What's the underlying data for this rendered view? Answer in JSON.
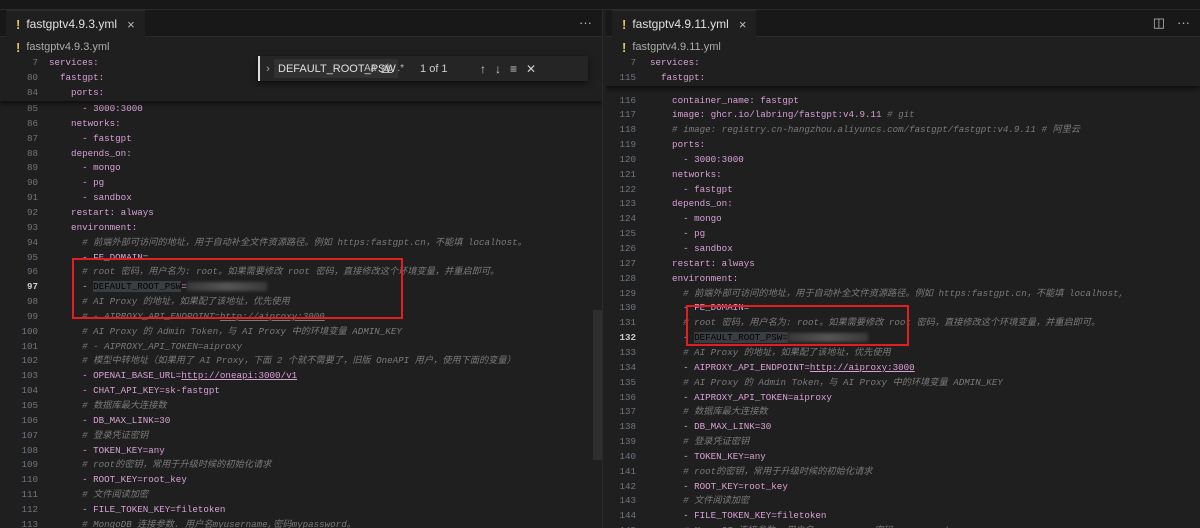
{
  "colors": {
    "background": "#1f1f1f",
    "key": "#d8a0d6",
    "comment": "#7a7a7a",
    "highlight_box": "#e02020"
  },
  "find_widget": {
    "query": "DEFAULT_ROOT_PSW",
    "match_case": "Aa",
    "whole_word": "ab",
    "regex": ".*",
    "count": "1 of 1",
    "icons": [
      "arrow-up-icon",
      "arrow-down-icon",
      "find-in-selection-icon",
      "close-icon"
    ]
  },
  "left": {
    "tab": "fastgptv4.9.3.yml",
    "breadcrumb": "fastgptv4.9.3.yml",
    "current_line": "97",
    "sticky": [
      {
        "num": "7",
        "segs": [
          [
            "services:",
            "key"
          ]
        ]
      },
      {
        "num": "80",
        "segs": [
          [
            "  fastgpt:",
            "key"
          ]
        ]
      },
      {
        "num": "84",
        "segs": [
          [
            "    ports:",
            "key"
          ]
        ]
      }
    ],
    "lines": [
      {
        "num": "85",
        "segs": [
          [
            "      - 3000:3000",
            "item"
          ]
        ]
      },
      {
        "num": "86",
        "segs": [
          [
            "    networks:",
            "key"
          ]
        ]
      },
      {
        "num": "87",
        "segs": [
          [
            "      - fastgpt",
            "item"
          ]
        ]
      },
      {
        "num": "88",
        "segs": [
          [
            "    depends_on:",
            "key"
          ]
        ]
      },
      {
        "num": "89",
        "segs": [
          [
            "      - mongo",
            "item"
          ]
        ]
      },
      {
        "num": "90",
        "segs": [
          [
            "      - pg",
            "item"
          ]
        ]
      },
      {
        "num": "91",
        "segs": [
          [
            "      - sandbox",
            "item"
          ]
        ]
      },
      {
        "num": "92",
        "segs": [
          [
            "    restart: always",
            "key"
          ]
        ]
      },
      {
        "num": "93",
        "segs": [
          [
            "    environment:",
            "key"
          ]
        ]
      },
      {
        "num": "94",
        "segs": [
          [
            "      # 前端外部可访问的地址，用于自动补全文件资源路径。例如 https:fastgpt.cn，不能填 localhost。",
            "comment"
          ]
        ]
      },
      {
        "num": "95",
        "segs": [
          [
            "      - FE_DOMAIN=",
            "item"
          ]
        ]
      },
      {
        "num": "96",
        "segs": [
          [
            "      # root 密码，用户名为: root。如果需要修改 root 密码，直接修改这个环境变量，并重启即可。",
            "comment"
          ]
        ]
      },
      {
        "num": "97",
        "segs": [
          [
            "      - ",
            "item"
          ],
          [
            "DEFAULT_ROOT_PSW",
            "sel"
          ],
          [
            "=",
            "item"
          ],
          [
            "",
            "blur"
          ]
        ]
      },
      {
        "num": "98",
        "segs": [
          [
            "      # AI Proxy 的地址，如果配了该地址，优先使用",
            "comment"
          ]
        ]
      },
      {
        "num": "99",
        "segs": [
          [
            "      # - AIPROXY_API_ENDPOINT=",
            "comment"
          ],
          [
            "http://aiproxy:3000",
            "comment link"
          ]
        ]
      },
      {
        "num": "100",
        "segs": [
          [
            "      # AI Proxy 的 Admin Token，与 AI Proxy 中的环境变量 ADMIN_KEY",
            "comment"
          ]
        ]
      },
      {
        "num": "101",
        "segs": [
          [
            "      # - AIPROXY_API_TOKEN=aiproxy",
            "comment"
          ]
        ]
      },
      {
        "num": "102",
        "segs": [
          [
            "      # 模型中转地址（如果用了 AI Proxy，下面 2 个就不需要了，旧版 OneAPI 用户，使用下面的变量）",
            "comment"
          ]
        ]
      },
      {
        "num": "103",
        "segs": [
          [
            "      - OPENAI_BASE_URL=",
            "item"
          ],
          [
            "http://oneapi:3000/v1",
            "link"
          ]
        ]
      },
      {
        "num": "104",
        "segs": [
          [
            "      - CHAT_API_KEY=sk-fastgpt",
            "item"
          ]
        ]
      },
      {
        "num": "105",
        "segs": [
          [
            "      # 数据库最大连接数",
            "comment"
          ]
        ]
      },
      {
        "num": "106",
        "segs": [
          [
            "      - DB_MAX_LINK=30",
            "item"
          ]
        ]
      },
      {
        "num": "107",
        "segs": [
          [
            "      # 登录凭证密钥",
            "comment"
          ]
        ]
      },
      {
        "num": "108",
        "segs": [
          [
            "      - TOKEN_KEY=any",
            "item"
          ]
        ]
      },
      {
        "num": "109",
        "segs": [
          [
            "      # root的密钥，常用于升级时候的初始化请求",
            "comment"
          ]
        ]
      },
      {
        "num": "110",
        "segs": [
          [
            "      - ROOT_KEY=root_key",
            "item"
          ]
        ]
      },
      {
        "num": "111",
        "segs": [
          [
            "      # 文件阅读加密",
            "comment"
          ]
        ]
      },
      {
        "num": "112",
        "segs": [
          [
            "      - FILE_TOKEN_KEY=filetoken",
            "item"
          ]
        ]
      },
      {
        "num": "113",
        "segs": [
          [
            "      # MongoDB 连接参数. 用户名myusername,密码mypassword。",
            "comment"
          ]
        ]
      }
    ]
  },
  "right": {
    "tab": "fastgptv4.9.11.yml",
    "breadcrumb": "fastgptv4.9.11.yml",
    "current_line": "132",
    "sticky": [
      {
        "num": "7",
        "segs": [
          [
            "services:",
            "key"
          ]
        ]
      },
      {
        "num": "115",
        "segs": [
          [
            "  fastgpt:",
            "key"
          ]
        ]
      }
    ],
    "lines": [
      {
        "num": "116",
        "segs": [
          [
            "    container_name: fastgpt",
            "key"
          ]
        ]
      },
      {
        "num": "117",
        "segs": [
          [
            "    image: ghcr.io/labring/fastgpt:v4.9.11 ",
            "key"
          ],
          [
            "# git",
            "comment"
          ]
        ]
      },
      {
        "num": "118",
        "segs": [
          [
            "    # image: registry.cn-hangzhou.aliyuncs.com/fastgpt/fastgpt:v4.9.11 # 阿里云",
            "comment"
          ]
        ]
      },
      {
        "num": "119",
        "segs": [
          [
            "    ports:",
            "key"
          ]
        ]
      },
      {
        "num": "120",
        "segs": [
          [
            "      - 3000:3000",
            "item"
          ]
        ]
      },
      {
        "num": "121",
        "segs": [
          [
            "    networks:",
            "key"
          ]
        ]
      },
      {
        "num": "122",
        "segs": [
          [
            "      - fastgpt",
            "item"
          ]
        ]
      },
      {
        "num": "123",
        "segs": [
          [
            "    depends_on:",
            "key"
          ]
        ]
      },
      {
        "num": "124",
        "segs": [
          [
            "      - mongo",
            "item"
          ]
        ]
      },
      {
        "num": "125",
        "segs": [
          [
            "      - pg",
            "item"
          ]
        ]
      },
      {
        "num": "126",
        "segs": [
          [
            "      - sandbox",
            "item"
          ]
        ]
      },
      {
        "num": "127",
        "segs": [
          [
            "    restart: always",
            "key"
          ]
        ]
      },
      {
        "num": "128",
        "segs": [
          [
            "    environment:",
            "key"
          ]
        ]
      },
      {
        "num": "129",
        "segs": [
          [
            "      # 前端外部可访问的地址，用于自动补全文件资源路径。例如 https:fastgpt.cn，不能填 localhost,",
            "comment"
          ]
        ]
      },
      {
        "num": "130",
        "segs": [
          [
            "      - FE_DOMAIN=",
            "item"
          ]
        ]
      },
      {
        "num": "131",
        "segs": [
          [
            "      # root 密码，用户名为: root。如果需要修改 root 密码，直接修改这个环境变量，并重启即可。",
            "comment"
          ]
        ]
      },
      {
        "num": "132",
        "segs": [
          [
            "      - ",
            "item"
          ],
          [
            "DEFAULT_ROOT_PSW=",
            "sel"
          ],
          [
            "",
            "blur"
          ]
        ]
      },
      {
        "num": "133",
        "segs": [
          [
            "      # AI Proxy 的地址，如果配了该地址，优先使用",
            "comment"
          ]
        ]
      },
      {
        "num": "134",
        "segs": [
          [
            "      - AIPROXY_API_ENDPOINT=",
            "item"
          ],
          [
            "http://aiproxy:3000",
            "link"
          ]
        ]
      },
      {
        "num": "135",
        "segs": [
          [
            "      # AI Proxy 的 Admin Token，与 AI Proxy 中的环境变量 ADMIN_KEY",
            "comment"
          ]
        ]
      },
      {
        "num": "136",
        "segs": [
          [
            "      - AIPROXY_API_TOKEN=aiproxy",
            "item"
          ]
        ]
      },
      {
        "num": "137",
        "segs": [
          [
            "      # 数据库最大连接数",
            "comment"
          ]
        ]
      },
      {
        "num": "138",
        "segs": [
          [
            "      - DB_MAX_LINK=30",
            "item"
          ]
        ]
      },
      {
        "num": "139",
        "segs": [
          [
            "      # 登录凭证密钥",
            "comment"
          ]
        ]
      },
      {
        "num": "140",
        "segs": [
          [
            "      - TOKEN_KEY=any",
            "item"
          ]
        ]
      },
      {
        "num": "141",
        "segs": [
          [
            "      # root的密钥，常用于升级时候的初始化请求",
            "comment"
          ]
        ]
      },
      {
        "num": "142",
        "segs": [
          [
            "      - ROOT_KEY=root_key",
            "item"
          ]
        ]
      },
      {
        "num": "143",
        "segs": [
          [
            "      # 文件阅读加密",
            "comment"
          ]
        ]
      },
      {
        "num": "144",
        "segs": [
          [
            "      - FILE_TOKEN_KEY=filetoken",
            "item"
          ]
        ]
      },
      {
        "num": "145",
        "segs": [
          [
            "      # MongoDB 连接参数. 用户名myusername,密码mypassword。",
            "comment"
          ]
        ]
      }
    ]
  }
}
